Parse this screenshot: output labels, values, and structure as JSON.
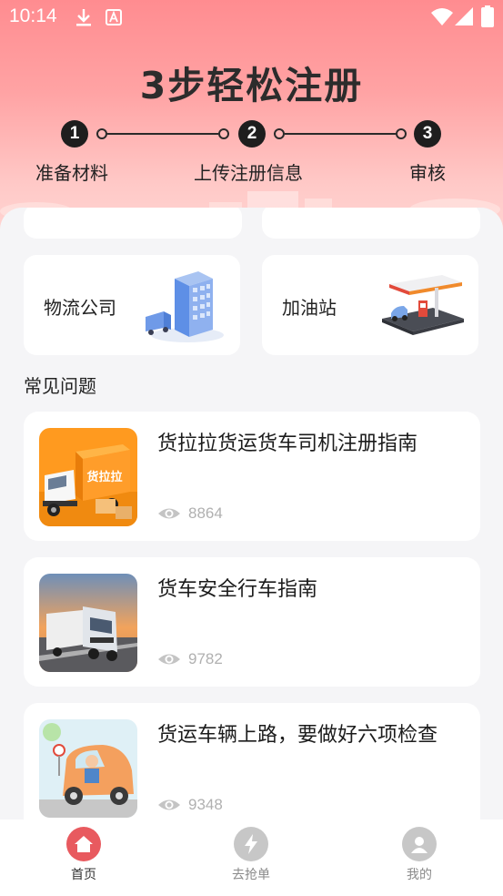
{
  "status": {
    "time": "10:14"
  },
  "hero": {
    "title": "3步轻松注册",
    "steps": [
      {
        "num": "1",
        "label": "准备材料"
      },
      {
        "num": "2",
        "label": "上传注册信息"
      },
      {
        "num": "3",
        "label": "审核"
      }
    ]
  },
  "categories": [
    {
      "label": "物流公司",
      "icon": "office-building-icon"
    },
    {
      "label": "加油站",
      "icon": "gas-station-icon"
    }
  ],
  "faq": {
    "title": "常见问题",
    "articles": [
      {
        "title": "货拉拉货运货车司机注册指南",
        "views": "8864",
        "thumb_text": "货拉拉"
      },
      {
        "title": "货车安全行车指南",
        "views": "9782"
      },
      {
        "title": "货运车辆上路，要做好六项检查",
        "views": "9348"
      }
    ]
  },
  "tabbar": {
    "items": [
      {
        "label": "首页",
        "icon": "home-icon",
        "active": true
      },
      {
        "label": "去抢单",
        "icon": "lightning-icon",
        "active": false
      },
      {
        "label": "我的",
        "icon": "user-icon",
        "active": false
      }
    ]
  },
  "colors": {
    "accent": "#e85a5f",
    "hero_top": "#ff8c90",
    "inactive_icon": "#c7c7c7"
  }
}
